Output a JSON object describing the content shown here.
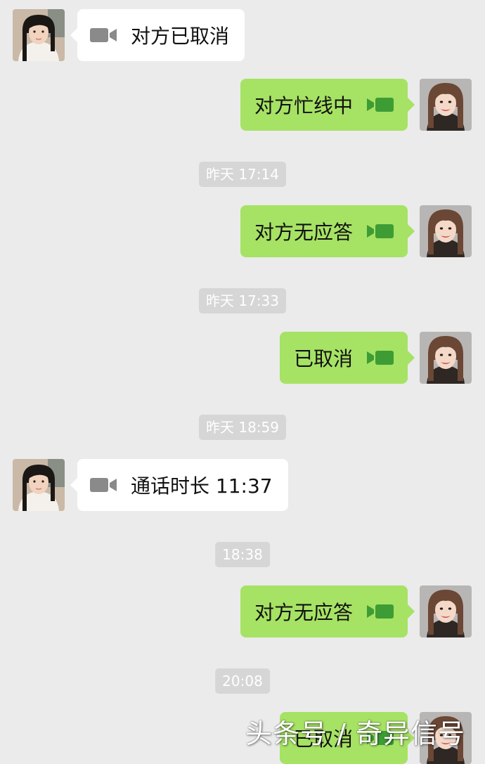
{
  "colors": {
    "background": "#ebebeb",
    "incoming_bubble": "#ffffff",
    "outgoing_bubble": "#a6e264",
    "timestamp_bg": "#d6d6d6"
  },
  "icons": {
    "call": "video-call-icon"
  },
  "messages": [
    {
      "sender": "contact",
      "kind": "video-call",
      "text": "对方已取消"
    },
    {
      "sender": "self",
      "kind": "video-call",
      "text": "对方忙线中"
    },
    {
      "kind": "timestamp",
      "text": "昨天 17:14"
    },
    {
      "sender": "self",
      "kind": "video-call",
      "text": "对方无应答"
    },
    {
      "kind": "timestamp",
      "text": "昨天 17:33"
    },
    {
      "sender": "self",
      "kind": "video-call",
      "text": "已取消"
    },
    {
      "kind": "timestamp",
      "text": "昨天 18:59"
    },
    {
      "sender": "contact",
      "kind": "video-call",
      "text": "通话时长 11:37"
    },
    {
      "kind": "timestamp",
      "text": "18:38"
    },
    {
      "sender": "self",
      "kind": "video-call",
      "text": "对方无应答"
    },
    {
      "kind": "timestamp",
      "text": "20:08"
    },
    {
      "sender": "self",
      "kind": "video-call",
      "text": "已取消"
    }
  ],
  "watermark": "头条号 / 奇异信号"
}
